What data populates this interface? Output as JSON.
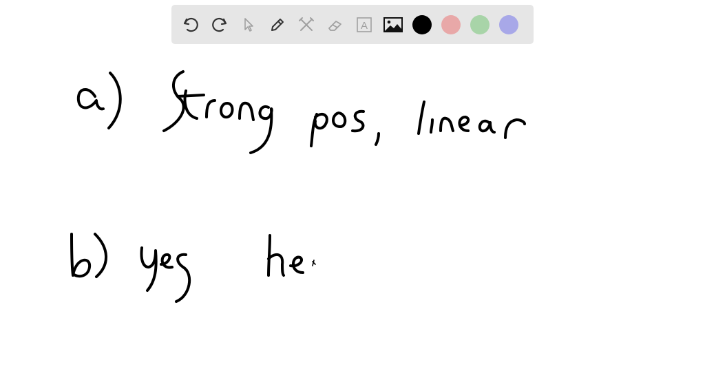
{
  "toolbar": {
    "tools": [
      {
        "name": "undo-icon"
      },
      {
        "name": "redo-icon"
      },
      {
        "name": "cursor-icon"
      },
      {
        "name": "pencil-icon"
      },
      {
        "name": "tools-icon"
      },
      {
        "name": "eraser-icon"
      },
      {
        "name": "text-icon",
        "glyph": "A"
      },
      {
        "name": "image-icon"
      }
    ],
    "colors": [
      {
        "name": "color-black",
        "hex": "#000000"
      },
      {
        "name": "color-pink",
        "hex": "#e8a8a8"
      },
      {
        "name": "color-green",
        "hex": "#a8d4a8"
      },
      {
        "name": "color-purple",
        "hex": "#a8a8e8"
      }
    ]
  },
  "ink": {
    "stroke_color": "#000000"
  }
}
